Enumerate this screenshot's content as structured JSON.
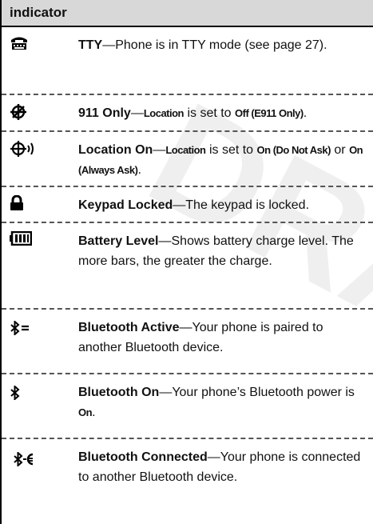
{
  "header": {
    "title": "indicator"
  },
  "watermark": {
    "text": "DRAFT",
    "color": "#cfcfcf"
  },
  "rows": [
    {
      "icon": "tty-icon",
      "term": "TTY",
      "text": "—Phone is in TTY mode (see page 27)."
    },
    {
      "icon": "location-off-icon",
      "term": "911 Only",
      "parts": [
        "—",
        "Location",
        " is set to ",
        "Off (E911 Only)",
        "."
      ]
    },
    {
      "icon": "location-on-icon",
      "term": "Location On",
      "parts": [
        "—",
        "Location",
        " is set to ",
        "On (Do Not Ask)",
        " or ",
        "On (Always Ask)",
        "."
      ]
    },
    {
      "icon": "lock-icon",
      "term": "Keypad Locked",
      "text": "—The keypad is locked."
    },
    {
      "icon": "battery-icon",
      "term": "Battery Level",
      "text": "—Shows battery charge level. The more bars, the greater the charge."
    },
    {
      "icon": "bluetooth-active-icon",
      "term": "Bluetooth Active",
      "text": "—Your phone is paired to another Bluetooth device."
    },
    {
      "icon": "bluetooth-on-icon",
      "term": "Bluetooth On",
      "parts": [
        "—Your phone’s Bluetooth power is ",
        "On",
        "."
      ]
    },
    {
      "icon": "bluetooth-connected-icon",
      "term": "Bluetooth Connected",
      "text": "—Your phone is connected to another Bluetooth device."
    }
  ]
}
